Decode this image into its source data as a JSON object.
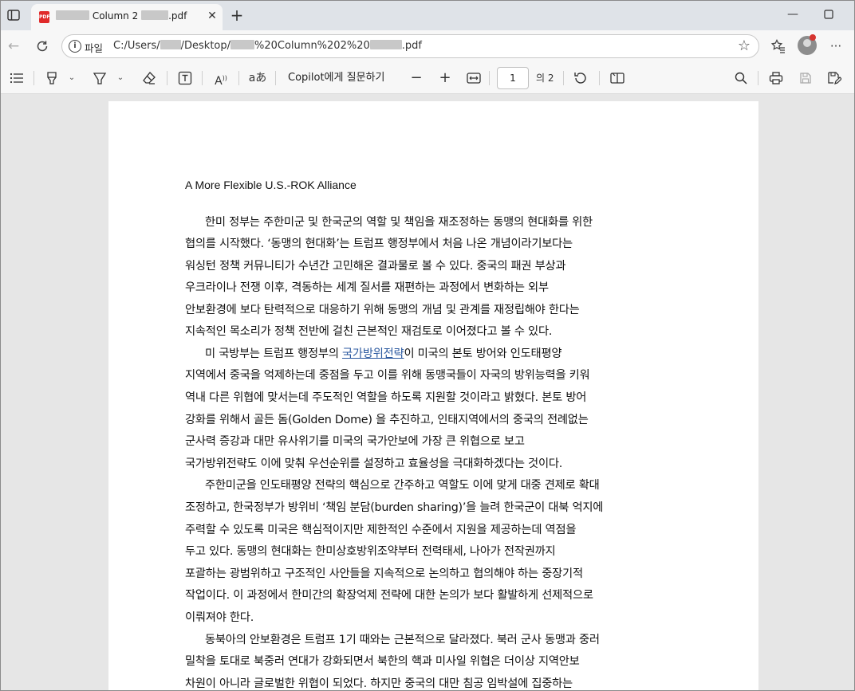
{
  "browser": {
    "tab": {
      "title_suffix": "Column 2",
      "ext": ".pdf"
    },
    "address": {
      "scheme_label": "파일",
      "path_a": "C:/Users/",
      "path_b": "/Desktop/",
      "path_c": "%20Column%202%20",
      "path_d": ".pdf"
    }
  },
  "toolbar": {
    "copilot_label": "Copilot에게 질문하기",
    "page_current": "1",
    "page_total": "의 2"
  },
  "document": {
    "title": "A More Flexible U.S.-ROK Alliance",
    "p2_pre": "미 국방부는 트럼프 행정부의 ",
    "p2_link": "국가방위전략",
    "p2_post": "이 미국의 본토 방어와 인도태평양",
    "lines": [
      "한미 정부는 주한미군 및 한국군의 역할 및 책임을 재조정하는 동맹의 현대화를 위한",
      "협의를 시작했다. ‘동맹의 현대화’는 트럼프 행정부에서 처음 나온 개념이라기보다는",
      "워싱턴 정책 커뮤니티가 수년간 고민해온 결과물로 볼 수 있다. 중국의 패권 부상과",
      "우크라이나 전쟁 이후, 격동하는 세계 질서를 재편하는 과정에서 변화하는 외부",
      "안보환경에 보다 탄력적으로 대응하기 위해 동맹의 개념 및 관계를 재정립해야 한다는",
      "지속적인 목소리가 정책 전반에 걸친 근본적인 재검토로 이어졌다고 볼 수 있다.",
      "지역에서 중국을 억제하는데 중점을 두고 이를 위해 동맹국들이 자국의 방위능력을 키워",
      "역내 다른 위협에 맞서는데 주도적인 역할을 하도록 지원할 것이라고 밝혔다. 본토 방어",
      "강화를 위해서 골든 돔(Golden Dome) 을 추진하고, 인태지역에서의 중국의 전례없는",
      "군사력 증강과 대만 유사위기를 미국의 국가안보에 가장 큰 위협으로 보고",
      "국가방위전략도 이에 맞춰 우선순위를 설정하고 효율성을 극대화하겠다는 것이다.",
      "주한미군을 인도태평양 전략의 핵심으로 간주하고 역할도 이에 맞게 대중 견제로 확대",
      "조정하고, 한국정부가 방위비 ‘책임 분담(burden sharing)’을 늘려  한국군이 대북 억지에",
      "주력할 수 있도록 미국은 핵심적이지만 제한적인 수준에서 지원을 제공하는데 역점을",
      "두고 있다. 동맹의 현대화는 한미상호방위조약부터 전력태세, 나아가 전작권까지",
      "포괄하는 광범위하고 구조적인 사안들을 지속적으로 논의하고 협의해야 하는 중장기적",
      "작업이다.  이 과정에서 한미간의 확장억제 전략에 대한 논의가 보다 활발하게 선제적으로",
      "이뤄져야 한다.",
      "동북아의 안보환경은 트럼프 1기 때와는 근본적으로 달라졌다. 북러 군사 동맹과 중러",
      "밀착을 토대로 북중러 연대가 강화되면서 북한의 핵과 미사일 위협은 더이상 지역안보",
      "차원이 아니라 글로벌한 위협이 되었다. 하지만 중국의 대만 침공 임박설에 집중하는"
    ]
  }
}
